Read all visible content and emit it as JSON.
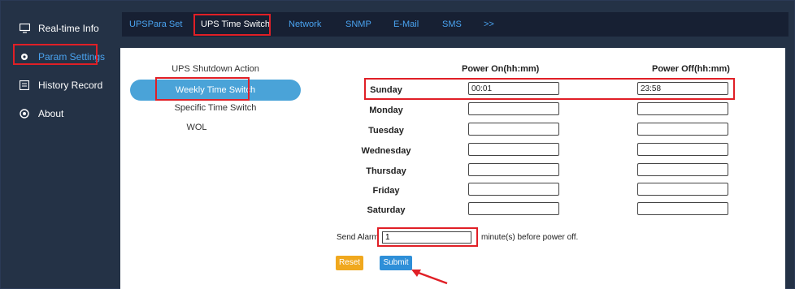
{
  "sidebar": {
    "items": [
      {
        "label": "Real-time Info",
        "icon": "monitor-icon"
      },
      {
        "label": "Param Settings",
        "icon": "gear-icon"
      },
      {
        "label": "History Record",
        "icon": "history-icon"
      },
      {
        "label": "About",
        "icon": "about-icon"
      }
    ],
    "active_index": 1
  },
  "topnav": {
    "tabs": [
      "UPSPara Set",
      "UPS Time Switch",
      "Network",
      "SNMP",
      "E-Mail",
      "SMS",
      ">>"
    ],
    "active_index": 1
  },
  "submenu": {
    "items": [
      "UPS Shutdown Action",
      "Weekly Time Switch",
      "Specific Time Switch",
      "WOL"
    ],
    "active_index": 1
  },
  "schedule": {
    "power_on_header": "Power On(hh:mm)",
    "power_off_header": "Power Off(hh:mm)",
    "rows": [
      {
        "day": "Sunday",
        "on": "00:01",
        "off": "23:58"
      },
      {
        "day": "Monday",
        "on": "",
        "off": ""
      },
      {
        "day": "Tuesday",
        "on": "",
        "off": ""
      },
      {
        "day": "Wednesday",
        "on": "",
        "off": ""
      },
      {
        "day": "Thursday",
        "on": "",
        "off": ""
      },
      {
        "day": "Friday",
        "on": "",
        "off": ""
      },
      {
        "day": "Saturday",
        "on": "",
        "off": ""
      }
    ]
  },
  "alarm": {
    "label": "Send Alarm",
    "value": "1",
    "suffix": "minute(s) before power off."
  },
  "buttons": {
    "reset": "Reset",
    "submit": "Submit"
  },
  "colors": {
    "sidebar_bg": "#243246",
    "topnav_bg": "#172033",
    "accent": "#4aa3f0",
    "highlight": "#e01f26",
    "reset": "#f0a81e",
    "submit": "#2e8fd8"
  }
}
